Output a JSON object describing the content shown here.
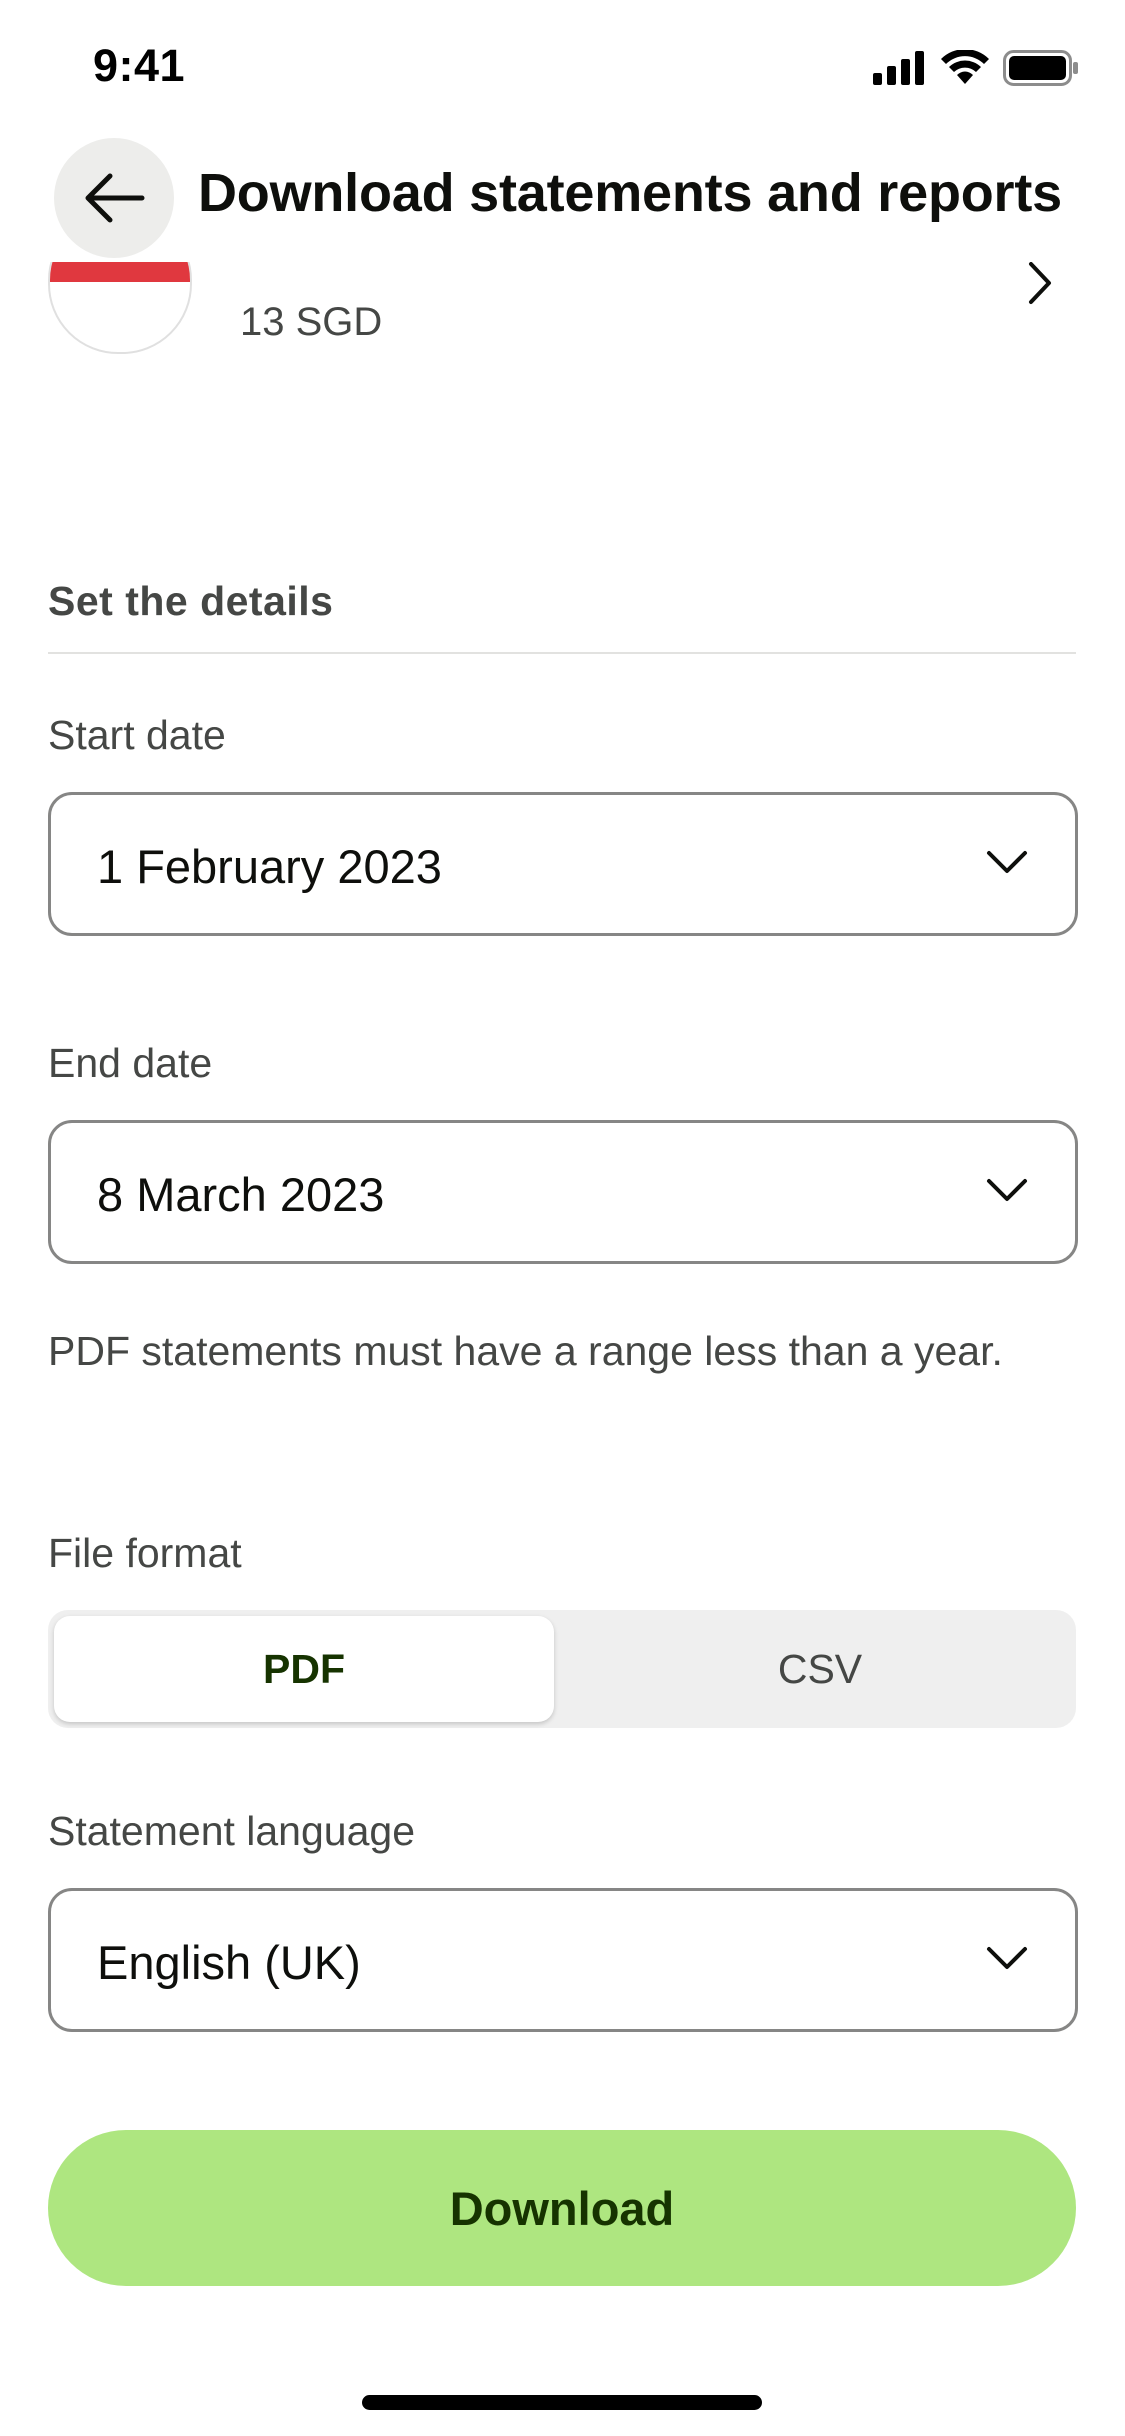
{
  "status_bar": {
    "time": "9:41",
    "icons": [
      "signal-icon",
      "wifi-icon",
      "battery-icon"
    ]
  },
  "header": {
    "back_icon": "arrow-left-icon",
    "title": "Download statements and reports"
  },
  "account": {
    "flag": "singapore-flag-icon",
    "amount": "13 SGD"
  },
  "details": {
    "section_title": "Set the details",
    "start_date": {
      "label": "Start date",
      "value": "1 February 2023"
    },
    "end_date": {
      "label": "End date",
      "value": "8 March 2023"
    },
    "helper_text": "PDF statements must have a range less than a year.",
    "file_format": {
      "label": "File format",
      "options": [
        "PDF",
        "CSV"
      ],
      "selected": "PDF"
    },
    "language": {
      "label": "Statement language",
      "value": "English (UK)"
    }
  },
  "actions": {
    "download_label": "Download"
  },
  "colors": {
    "accent": "#aee680",
    "accent_text": "#163300",
    "flag_red": "#e0383f"
  }
}
